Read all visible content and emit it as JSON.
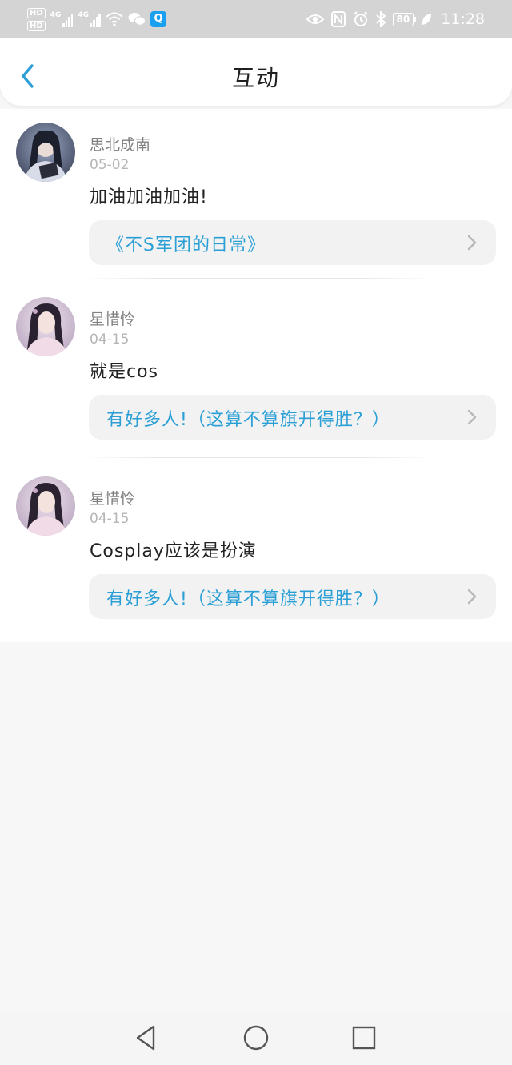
{
  "status_bar": {
    "hd_label": "HD",
    "network_label": "4G",
    "battery": "80",
    "time": "11:28",
    "app_icon_label": "Q"
  },
  "header": {
    "title": "互动"
  },
  "colors": {
    "accent": "#2a9fd6",
    "page_background": "#f8f7f8",
    "card_background": "#ffffff",
    "reference_background": "#f2f2f2"
  },
  "items": [
    {
      "username": "思北成南",
      "date": "05-02",
      "content": "加油加油加油!",
      "reference": "《不S军团的日常》"
    },
    {
      "username": "星惜怜",
      "date": "04-15",
      "content": "就是cos",
      "reference": "有好多人!（这算不算旗开得胜？）"
    },
    {
      "username": "星惜怜",
      "date": "04-15",
      "content": "Cosplay应该是扮演",
      "reference": "有好多人!（这算不算旗开得胜？）"
    }
  ]
}
